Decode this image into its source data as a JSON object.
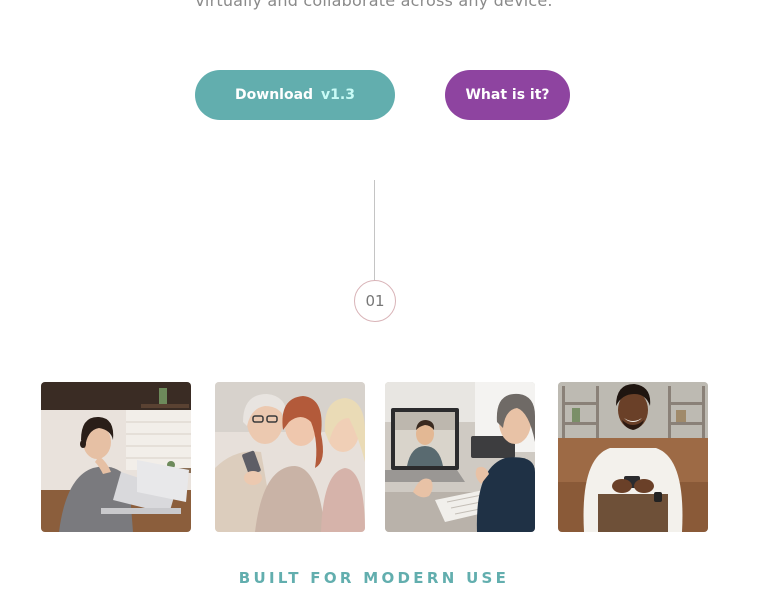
{
  "hero": {
    "tagline": "virtually and collaborate across any device."
  },
  "buttons": {
    "download_label": "Download",
    "download_version": "v1.3",
    "what_label": "What is it?"
  },
  "step": {
    "number": "01"
  },
  "photos": [
    {
      "name": "woman-laptop-photo"
    },
    {
      "name": "women-phone-photo"
    },
    {
      "name": "video-call-photo"
    },
    {
      "name": "man-phone-photo"
    }
  ],
  "section": {
    "title": "BUILT FOR MODERN USE"
  },
  "colors": {
    "download_bg": "#62aeae",
    "download_version": "#c8fbf6",
    "what_bg": "#8e44a0",
    "title": "#62aeae",
    "connector": "#c4c4c4",
    "circle_border": "#d9b4b8"
  }
}
